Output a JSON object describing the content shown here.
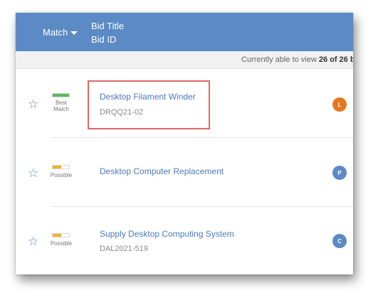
{
  "header": {
    "match_label": "Match",
    "title_label": "Bid Title",
    "id_label": "Bid ID",
    "background": "#5b8ac4"
  },
  "status": {
    "prefix": "Currently able to view ",
    "count": "26 of 26 b"
  },
  "rows": [
    {
      "match_label_line1": "Best",
      "match_label_line2": "Match",
      "match_level": 1.0,
      "match_color": "#5cb85c",
      "title": "Desktop Filament Winder",
      "bid_id": "DRQQ21-02",
      "avatar_letter": "L",
      "avatar_color": "#e8781e",
      "highlighted": true
    },
    {
      "match_label_line1": "Possible",
      "match_level": 0.5,
      "match_color": "#f0b429",
      "title": "Desktop Computer Replacement",
      "bid_id": "",
      "avatar_letter": "P",
      "avatar_color": "#5b8ac4"
    },
    {
      "match_label_line1": "Possible",
      "match_level": 0.5,
      "match_color": "#f0b429",
      "title": "Supply Desktop Computing System",
      "bid_id": "DAL2021-519",
      "avatar_letter": "C",
      "avatar_color": "#5b8ac4"
    }
  ],
  "icons": {
    "star": "star-outline-icon",
    "caret": "caret-down-icon"
  }
}
